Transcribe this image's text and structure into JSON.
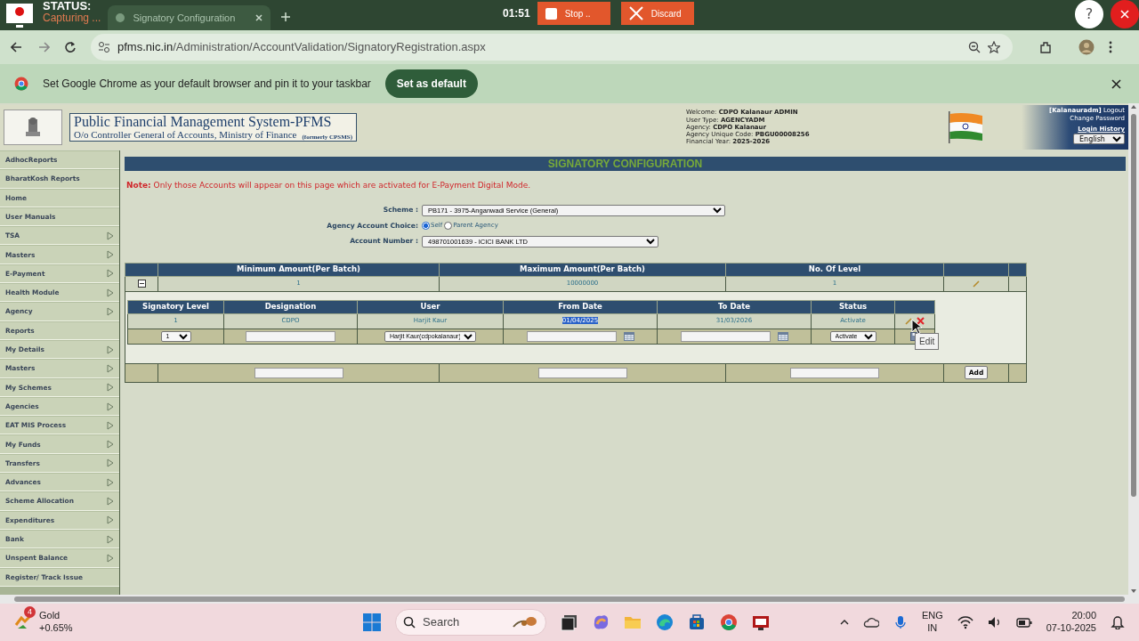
{
  "recorder": {
    "status_label": "STATUS:",
    "status": "Capturing ...",
    "timer": "01:51",
    "stop": "Stop ..",
    "discard": "Discard",
    "help": "?"
  },
  "browser": {
    "tab_title": "Signatory Configuration",
    "url_domain": "pfms.nic.in",
    "url_path": "/Administration/AccountValidation/SignatoryRegistration.aspx",
    "infobar_text": "Set Google Chrome as your default browser and pin it to your taskbar",
    "infobar_button": "Set as default"
  },
  "header": {
    "title": "Public Financial Management System-PFMS",
    "subtitle": "O/o Controller General of Accounts, Ministry of Finance",
    "formerly": "(formerly CPSMS)",
    "user_info": [
      {
        "label": "Welcome:",
        "value": "CDPO Kalanaur ADMIN"
      },
      {
        "label": "User Type:",
        "value": "AGENCYADM"
      },
      {
        "label": "Agency:",
        "value": "CDPO Kalanaur"
      },
      {
        "label": "Agency Unique Code:",
        "value": "PBGU00008256"
      },
      {
        "label": "Financial Year:",
        "value": "2025-2026"
      }
    ],
    "username": "[Kalanauradm]",
    "logout": "Logout",
    "change_password": "Change Password",
    "login_history": "Login History",
    "language": "English"
  },
  "sidebar": {
    "items": [
      {
        "label": "AdhocReports",
        "has_submenu": false
      },
      {
        "label": "BharatKosh Reports",
        "has_submenu": false
      },
      {
        "label": "Home",
        "has_submenu": false
      },
      {
        "label": "User Manuals",
        "has_submenu": false
      },
      {
        "label": "TSA",
        "has_submenu": true
      },
      {
        "label": "Masters",
        "has_submenu": true
      },
      {
        "label": "E-Payment",
        "has_submenu": true
      },
      {
        "label": "Health Module",
        "has_submenu": true
      },
      {
        "label": "Agency",
        "has_submenu": true
      },
      {
        "label": "Reports",
        "has_submenu": false
      },
      {
        "label": "My Details",
        "has_submenu": true
      },
      {
        "label": "Masters",
        "has_submenu": true
      },
      {
        "label": "My Schemes",
        "has_submenu": true
      },
      {
        "label": "Agencies",
        "has_submenu": true
      },
      {
        "label": "EAT MIS Process",
        "has_submenu": true
      },
      {
        "label": "My Funds",
        "has_submenu": true
      },
      {
        "label": "Transfers",
        "has_submenu": true
      },
      {
        "label": "Advances",
        "has_submenu": true
      },
      {
        "label": "Scheme Allocation",
        "has_submenu": true
      },
      {
        "label": "Expenditures",
        "has_submenu": true
      },
      {
        "label": "Bank",
        "has_submenu": true
      },
      {
        "label": "Unspent Balance",
        "has_submenu": true
      },
      {
        "label": "Register/ Track Issue",
        "has_submenu": false
      }
    ]
  },
  "page": {
    "title": "SIGNATORY CONFIGURATION",
    "note_label": "Note:",
    "note": "Only those Accounts will appear on this page which are activated for E-Payment Digital Mode.",
    "form": {
      "scheme_label": "Scheme :",
      "scheme": "PB171 - 3975-Anganwadi Service (General)",
      "choice_label": "Agency Account Choice:",
      "choices": [
        {
          "label": "Self",
          "selected": true
        },
        {
          "label": "Parent Agency",
          "selected": false
        }
      ],
      "account_label": "Account Number :",
      "account": "498701001639 - ICICI BANK LTD"
    },
    "levels_table": {
      "columns": [
        "Minimum Amount(Per Batch)",
        "Maximum Amount(Per Batch)",
        "No. Of Level"
      ],
      "row": [
        "1",
        "10000000",
        "1"
      ],
      "expanded": true
    },
    "signatory_table": {
      "columns": [
        "Signatory Level",
        "Designation",
        "User",
        "From Date",
        "To Date",
        "Status"
      ],
      "rows": [
        {
          "cells": [
            {
              "text": "1",
              "highlighted": false
            },
            {
              "text": "CDPO",
              "highlighted": false
            },
            {
              "text": "Harjit Kaur",
              "highlighted": false
            },
            {
              "text": "01/04/2025",
              "highlighted": true
            },
            {
              "text": "31/03/2026",
              "highlighted": false
            },
            {
              "text": "Activate",
              "highlighted": false
            }
          ]
        }
      ],
      "new_row": {
        "level": "1",
        "user": "Harjit Kaur(cdpokalanaur)",
        "status": "Activate"
      }
    },
    "add_button": "Add",
    "tooltip": "Edit"
  },
  "taskbar": {
    "badge": "4",
    "stock_name": "Gold",
    "stock_change": "+0.65%",
    "search": "Search",
    "language": "ENG",
    "region": "IN",
    "time": "20:00",
    "date": "07-10-2025"
  }
}
